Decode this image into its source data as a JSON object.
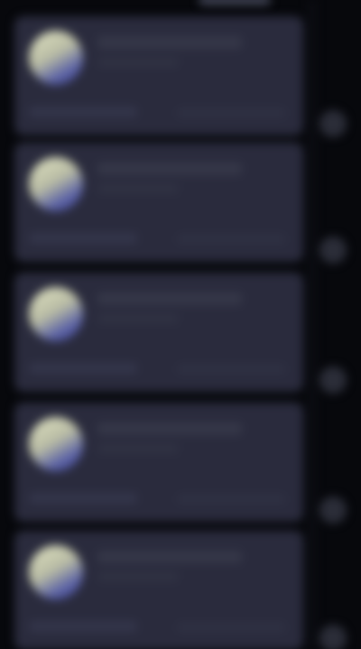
{
  "feed": {
    "items": [
      {
        "title": "",
        "subtitle": "",
        "footer": "",
        "meta": "",
        "avatar_icon": "avatar-image",
        "action_icon": "more-icon"
      },
      {
        "title": "",
        "subtitle": "",
        "footer": "",
        "meta": "",
        "avatar_icon": "avatar-image",
        "action_icon": "more-icon"
      },
      {
        "title": "",
        "subtitle": "",
        "footer": "",
        "meta": "",
        "avatar_icon": "avatar-image",
        "action_icon": "more-icon"
      },
      {
        "title": "",
        "subtitle": "",
        "footer": "",
        "meta": "",
        "avatar_icon": "avatar-image",
        "action_icon": "more-icon"
      },
      {
        "title": "",
        "subtitle": "",
        "footer": "",
        "meta": "",
        "avatar_icon": "avatar-image",
        "action_icon": "more-icon"
      }
    ]
  },
  "colors": {
    "background": "#07080c",
    "card": "#2a2b3d",
    "avatar_light": "#dfe2c2",
    "avatar_dark": "#3b4088",
    "action": "#2b2d38"
  }
}
